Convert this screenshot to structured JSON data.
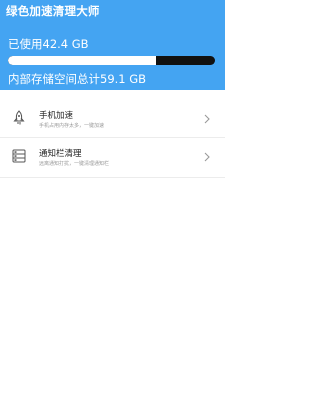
{
  "header": {
    "title": "绿色加速清理大师",
    "used_label": "已使用42.4 GB",
    "total_label": "内部存储空间总计59.1 GB",
    "used_fraction": 0.717,
    "bg_color": "#44a4f2"
  },
  "list": {
    "items": [
      {
        "title": "手机加速",
        "subtitle": "手机占用内存太多，一键加速",
        "icon": "rocket-icon"
      },
      {
        "title": "通知栏清理",
        "subtitle": "远离通知打扰，一键清理通知栏",
        "icon": "notification-bar-icon"
      }
    ]
  }
}
